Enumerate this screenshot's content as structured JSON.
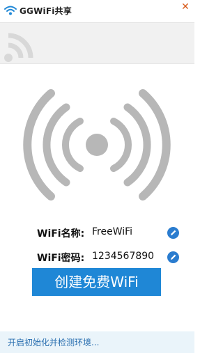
{
  "window": {
    "title": "GGWiFi共享",
    "close_icon": "close-icon"
  },
  "colors": {
    "accent": "#1f87d6",
    "icon_blue": "#2a7ccf",
    "close": "#d85a1a",
    "status_text": "#2a6fb0",
    "hero_gray": "#b7b7b7"
  },
  "wifi_form": {
    "name_label": "WiFi名称:",
    "name_value": "FreeWiFi",
    "password_label": "WiFi密码:",
    "password_value": "1234567890",
    "edit_icon": "pencil-icon"
  },
  "actions": {
    "create_label": "创建免费WiFi"
  },
  "status": {
    "message": "开启初始化并检测环境..."
  }
}
